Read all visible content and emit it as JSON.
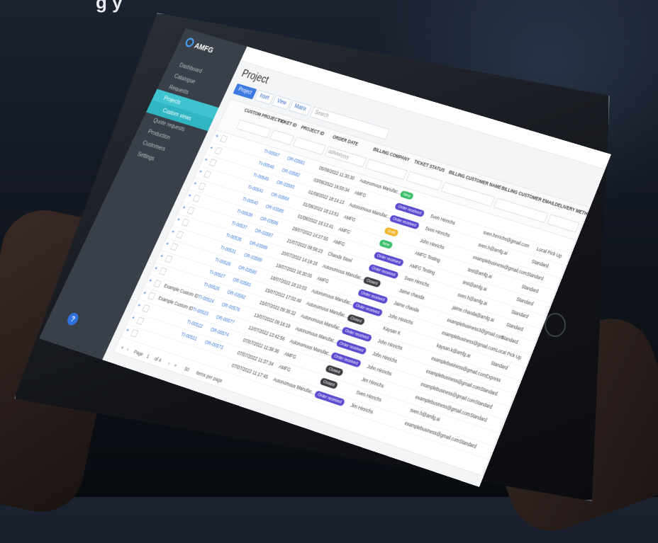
{
  "headline": "g        y",
  "app": {
    "logo": "AMFG",
    "sidebar": [
      {
        "label": "Dashboard"
      },
      {
        "label": "Catalogue"
      },
      {
        "label": "Requests"
      },
      {
        "label": "Projects",
        "active": true
      },
      {
        "label": "Custom views",
        "sub": true
      },
      {
        "label": "Quote requests"
      },
      {
        "label": "Production"
      },
      {
        "label": "Customers"
      },
      {
        "label": "Settings"
      }
    ],
    "help_label": "?",
    "page_title": "Project",
    "tabs": [
      "Project",
      "Inset",
      "View",
      "Matrix"
    ],
    "search_placeholder": "Search",
    "columns": [
      "CUSTOM PROJECT ID",
      "TICKET ID",
      "PROJECT ID",
      "ORDER DATE",
      "BILLING COMPANY",
      "TICKET STATUS",
      "BILLING CUSTOMER NAME",
      "BILLING CUSTOMER EMAIL",
      "DELIVERY METHOD"
    ],
    "order_date_filter": "dd/MM/yyyy",
    "rows": [
      {
        "custom": "",
        "ticket": "TI-00567",
        "project": "OR-03581",
        "date": "05/08/2022 11:30:30",
        "company": "Autonomous Manufac...",
        "status": "New",
        "color": "#3cbf6a",
        "name": "",
        "email": "",
        "delivery": ""
      },
      {
        "custom": "",
        "ticket": "TI-00546",
        "project": "OR-03582",
        "date": "03/08/2022 16:50:34",
        "company": "AMFG",
        "status": "Order received",
        "color": "#5b4bd0",
        "name": "Sven Hinrichs",
        "email": "sven.hinrichs@gmail.com",
        "delivery": "Local Pick Up"
      },
      {
        "custom": "",
        "ticket": "TI-00545",
        "project": "OR-03583",
        "date": "01/08/2022 18:14:13",
        "company": "Autonomous Manufac...",
        "status": "Order received",
        "color": "#5b4bd0",
        "name": "Sven Hinrichs",
        "email": "sven.h@amfg.ai",
        "delivery": "Standard"
      },
      {
        "custom": "",
        "ticket": "TI-00541",
        "project": "OR-03584",
        "date": "01/08/2022 18:13:51",
        "company": "AMFG",
        "status": "Draft",
        "color": "#f0b429",
        "name": "John Hinrichs",
        "email": "examplebusiness@gmail.com",
        "delivery": "Standard"
      },
      {
        "custom": "",
        "ticket": "TI-00540",
        "project": "OR-03585",
        "date": "01/08/2022 18:13:41",
        "company": "AMFG",
        "status": "New",
        "color": "#3cbf6a",
        "name": "AMFG Testing",
        "email": "test@amfg.ai",
        "delivery": "Standard"
      },
      {
        "custom": "",
        "ticket": "TI-00538",
        "project": "OR-03586",
        "date": "28/07/2022 14:27:55",
        "company": "AMFG",
        "status": "Order received",
        "color": "#5b4bd0",
        "name": "AMFG Testing",
        "email": "test@amfg.ai",
        "delivery": "Standard"
      },
      {
        "custom": "",
        "ticket": "TI-00537",
        "project": "OR-03587",
        "date": "21/07/2022 09:58:23",
        "company": "Chaoda Steel",
        "status": "Order received",
        "color": "#5b4bd0",
        "name": "Sven Hinrichs",
        "email": "sven.h@amfg.ai",
        "delivery": "Standard"
      },
      {
        "custom": "",
        "ticket": "TI-00536",
        "project": "OR-03588",
        "date": "20/07/2022 14:19:18",
        "company": "Autonomous Manufac...",
        "status": "Closed",
        "color": "#3d3f44",
        "name": "Jaime chaoda",
        "email": "jaime.chaoda@amfg.ai",
        "delivery": "Standard"
      },
      {
        "custom": "",
        "ticket": "TI-00531",
        "project": "OR-03589",
        "date": "19/07/2022 16:30:05",
        "company": "AMFG",
        "status": "Order received",
        "color": "#5b4bd0",
        "name": "Jaime chaoda",
        "email": "examplebusiness3@gmail.com",
        "delivery": "Standard"
      },
      {
        "custom": "",
        "ticket": "TI-00528",
        "project": "OR-03590",
        "date": "18/07/2022 18:10:03",
        "company": "Autonomous Manufac...",
        "status": "Order received",
        "color": "#5b4bd0",
        "name": "John Hinrichs",
        "email": "examplebusiness@gmail.com",
        "delivery": "Local Pick Up"
      },
      {
        "custom": "",
        "ticket": "TI-00527",
        "project": "OR-03591",
        "date": "15/07/2022 17:02:49",
        "company": "Autonomous Manufac...",
        "status": "Closed",
        "color": "#3d3f44",
        "name": "Kaysan K",
        "email": "kaysan.k@amfg.ai",
        "delivery": "Standard"
      },
      {
        "custom": "",
        "ticket": "TI-00526",
        "project": "OR-03592",
        "date": "15/07/2022 09:36:32",
        "company": "Autonomous Manufac...",
        "status": "Order received",
        "color": "#5b4bd0",
        "name": "John Hinrichs",
        "email": "examplebusiness@gmail.com",
        "delivery": "Express"
      },
      {
        "custom": "Example Custom ID",
        "ticket": "TI-00524",
        "project": "OR-00576",
        "date": "13/07/2022 09:18:19",
        "company": "Autonomous Manufac...",
        "status": "Order received",
        "color": "#5b4bd0",
        "name": "John Hinrichs",
        "email": "examplebusiness@gmail.com",
        "delivery": "Standard"
      },
      {
        "custom": "Example Custom ID",
        "ticket": "TI-00523",
        "project": "OR-00577",
        "date": "12/07/2022 13:42:56",
        "company": "Autonomous Manufac...",
        "status": "Order received",
        "color": "#5b4bd0",
        "name": "John Hinrichs",
        "email": "examplebusiness@gmail.com",
        "delivery": "Standard"
      },
      {
        "custom": "",
        "ticket": "TI-00522",
        "project": "OR-00574",
        "date": "07/07/2022 11:38:36",
        "company": "AMFG",
        "status": "Closed",
        "color": "#3d3f44",
        "name": "Jim Hinrichs",
        "email": "examplebusiness@gmail.com",
        "delivery": "Standard"
      },
      {
        "custom": "",
        "ticket": "TI-00521",
        "project": "OR-00573",
        "date": "07/07/2022 11:37:34",
        "company": "AMFG",
        "status": "Closed",
        "color": "#3d3f44",
        "name": "Sven Hinrichs",
        "email": "sven.h@amfg.ai",
        "delivery": ""
      },
      {
        "custom": "",
        "ticket": "",
        "project": "",
        "date": "07/07/2022 11:17:45",
        "company": "Autonomous Manufac...",
        "status": "Order received",
        "color": "#5b4bd0",
        "name": "Jim Hinrichs",
        "email": "examplebusiness@gmail.com",
        "delivery": "Standard"
      }
    ],
    "pager": {
      "page_label": "Page",
      "page": "1",
      "of": "of 4",
      "per_page": "50",
      "per_page_label": "items per page"
    }
  }
}
